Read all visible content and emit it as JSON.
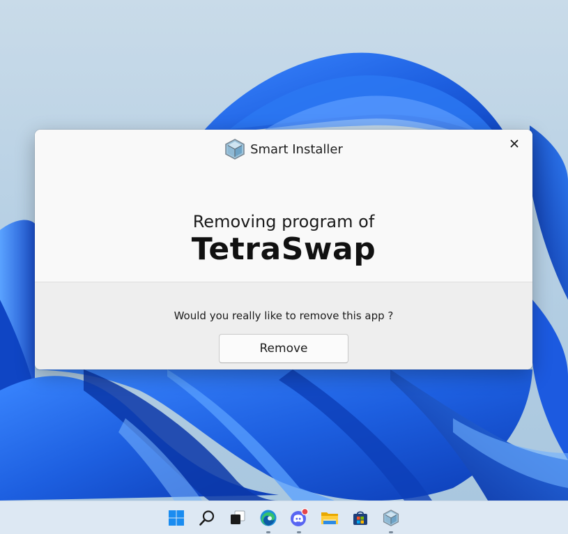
{
  "dialog": {
    "window_title": "Smart Installer",
    "heading_sub": "Removing program of",
    "heading_main": "TetraSwap",
    "question": "Would you really like to remove this app ?",
    "remove_label": "Remove",
    "close_icon": "close-icon",
    "logo_icon": "cube-icon"
  },
  "taskbar": {
    "items": [
      {
        "icon": "windows-start-icon",
        "running": false
      },
      {
        "icon": "search-icon",
        "running": false
      },
      {
        "icon": "task-view-icon",
        "running": false
      },
      {
        "icon": "edge-browser-icon",
        "running": true
      },
      {
        "icon": "discord-icon",
        "running": true,
        "notification": true
      },
      {
        "icon": "file-explorer-icon",
        "running": false
      },
      {
        "icon": "microsoft-store-icon",
        "running": false
      },
      {
        "icon": "smart-installer-icon",
        "running": true
      }
    ]
  },
  "colors": {
    "accent_blue": "#1f6fe0",
    "wallpaper_light": "#b7d0e4",
    "notification_red": "#e6454a"
  }
}
